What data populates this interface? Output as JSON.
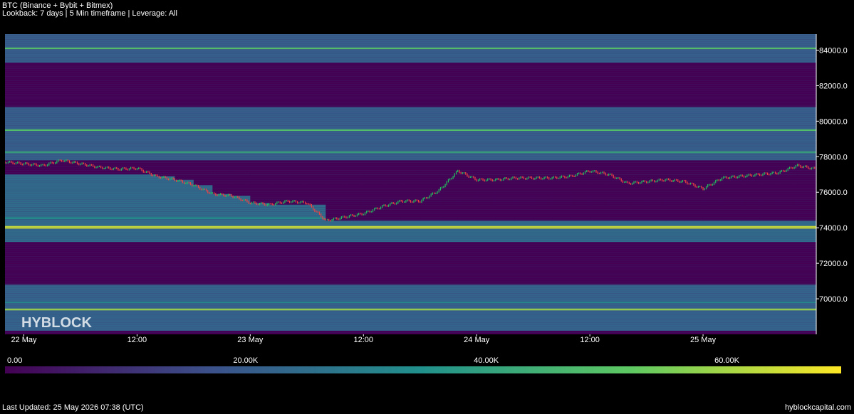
{
  "header": {
    "title": "BTC (Binance + Bybit + Bitmex)",
    "subtitle": "Lookback: 7 days | 5 Min timeframe | Leverage: All"
  },
  "watermark": "HYBLOCK",
  "footer": {
    "updated": "Last Updated: 25 May 2026 07:38 (UTC)",
    "site": "hyblockcapital.com"
  },
  "colors": {
    "background": "#000000",
    "candle_up": "#22c55e",
    "candle_down": "#ef4444",
    "colormap": [
      "#440154",
      "#3b528b",
      "#21918c",
      "#5ec962",
      "#fde725"
    ]
  },
  "chart_data": {
    "type": "heatmap",
    "title": "BTC (Binance + Bybit + Bitmex)",
    "subtitle": "Lookback: 7 days | 5 Min timeframe | Leverage: All",
    "y_axis": {
      "position": "right",
      "ticks": [
        "70000.0",
        "72000.0",
        "74000.0",
        "76000.0",
        "78000.0",
        "80000.0",
        "82000.0",
        "84000.0"
      ],
      "range": [
        68000,
        84900
      ]
    },
    "x_axis": {
      "ticks": [
        "22 May",
        "12:00",
        "23 May",
        "12:00",
        "24 May",
        "12:00",
        "25 May"
      ],
      "tick_hours": [
        0,
        12,
        24,
        36,
        48,
        60,
        72
      ],
      "range_hours": [
        -2,
        84
      ]
    },
    "colorbar": {
      "ticks": [
        "0.00",
        "20.00K",
        "40.00K",
        "60.00K"
      ],
      "tick_values": [
        0,
        20000,
        40000,
        60000
      ],
      "max": 69500
    },
    "liquidity_bands": [
      {
        "low": 68200,
        "high": 70800,
        "intensity": 0.32
      },
      {
        "low": 69350,
        "high": 69450,
        "intensity": 0.85
      },
      {
        "low": 69750,
        "high": 69850,
        "intensity": 0.45
      },
      {
        "low": 73200,
        "high": 77000,
        "intensity": 0.35
      },
      {
        "low": 73950,
        "high": 74100,
        "intensity": 0.92
      },
      {
        "low": 74500,
        "high": 74600,
        "intensity": 0.5
      },
      {
        "low": 77800,
        "high": 80800,
        "intensity": 0.3
      },
      {
        "low": 78200,
        "high": 78300,
        "intensity": 0.6
      },
      {
        "low": 79450,
        "high": 79550,
        "intensity": 0.7
      },
      {
        "low": 83300,
        "high": 84900,
        "intensity": 0.3
      },
      {
        "low": 84050,
        "high": 84150,
        "intensity": 0.7
      }
    ],
    "price_series": {
      "name": "",
      "hours": [
        -2,
        0,
        2,
        4,
        6,
        8,
        10,
        12,
        14,
        16,
        18,
        20,
        22,
        24,
        26,
        28,
        30,
        32,
        34,
        36,
        38,
        40,
        42,
        44,
        46,
        48,
        50,
        52,
        54,
        56,
        58,
        60,
        62,
        64,
        66,
        68,
        70,
        72,
        74,
        76,
        78,
        80,
        82,
        84
      ],
      "values": [
        77700,
        77600,
        77500,
        77800,
        77600,
        77400,
        77300,
        77350,
        76900,
        76700,
        76400,
        75900,
        75800,
        75400,
        75300,
        75500,
        75400,
        74400,
        74600,
        74800,
        75200,
        75500,
        75500,
        76100,
        77200,
        76700,
        76700,
        76800,
        76800,
        76800,
        76900,
        77200,
        77000,
        76500,
        76600,
        76700,
        76600,
        76200,
        76800,
        76900,
        77000,
        77100,
        77500,
        77300
      ]
    }
  }
}
